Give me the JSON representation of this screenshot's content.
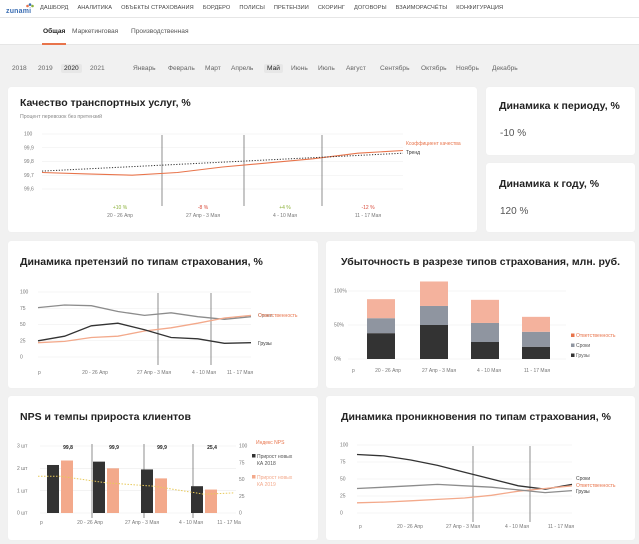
{
  "brand": {
    "logo_text": "zunami",
    "accent": "#e8744b",
    "dark": "#333333",
    "mid": "#8c8c8c"
  },
  "topnav": [
    "ДАШБОРД",
    "АНАЛИТИКА",
    "ОБЪЕКТЫ СТРАХОВАНИЯ",
    "БОРДЕРО",
    "ПОЛИСЫ",
    "ПРЕТЕНЗИИ",
    "СКОРИНГ",
    "ДОГОВОРЫ",
    "ВЗАИМОРАСЧЁТЫ",
    "КОНФИГУРАЦИЯ"
  ],
  "subtabs": [
    "Общая",
    "Маркетинговая",
    "Производственная"
  ],
  "years": [
    "2018",
    "2019",
    "2020",
    "2021"
  ],
  "selected_year": "2020",
  "months": [
    "Январь",
    "Февраль",
    "Март",
    "Апрель",
    "Май",
    "Июнь",
    "Июль",
    "Август",
    "Сентябрь",
    "Октябрь",
    "Ноябрь",
    "Декабрь"
  ],
  "selected_month": "Май",
  "cards": {
    "quality": {
      "title": "Качество транспортных услуг, %",
      "subtitle": "Процент перевозок без претензий"
    },
    "period": {
      "title": "Динамика к периоду, %",
      "value": "-10 %"
    },
    "year": {
      "title": "Динамика к году, %",
      "value": "120 %"
    },
    "claims": {
      "title": "Динамика претензий по типам страхования, %"
    },
    "loss": {
      "title": "Убыточность в разрезе типов страхования, млн. руб."
    },
    "nps": {
      "title": "NPS и темпы прироста клиентов"
    },
    "penetration": {
      "title": "Динамика проникновения по типам страхования, %"
    }
  },
  "chart_data": [
    {
      "type": "line",
      "title": "Качество транспортных услуг, %",
      "subtitle": "Процент перевозок без претензий",
      "x": [
        "20 - 26 Апр",
        "27 Апр - 3 Мая",
        "4 - 10 Мая",
        "11 - 17 Мая"
      ],
      "ylim": [
        99.6,
        100
      ],
      "yticks": [
        "100",
        "99,9",
        "99,8",
        "99,7",
        "99,6"
      ],
      "period_changes": [
        "+10 %",
        "-8 %",
        "+4 %",
        "-12 %"
      ],
      "change_colors": [
        "#8cb13a",
        "#d94a3a",
        "#8cb13a",
        "#d94a3a"
      ],
      "series": [
        {
          "name": "Коэффициент качества",
          "values": [
            99.72,
            99.71,
            99.7,
            99.72,
            99.76,
            99.79,
            99.82,
            99.86,
            99.88
          ]
        },
        {
          "name": "Тренд",
          "values": [
            99.73,
            99.86
          ]
        }
      ]
    },
    {
      "type": "line",
      "title": "Динамика претензий по типам страхования, %",
      "x": [
        "20 - 26 Апр",
        "27 Апр - 3 Мая",
        "4 - 10 Мая",
        "11 - 17 Мая"
      ],
      "first_tick": "р",
      "ylim": [
        0,
        100
      ],
      "yticks": [
        "100",
        "75",
        "50",
        "25",
        "0"
      ],
      "series": [
        {
          "name": "Сроки",
          "values": [
            76,
            80,
            79,
            70,
            64,
            68,
            62,
            58,
            62
          ]
        },
        {
          "name": "Ответственность",
          "values": [
            22,
            24,
            30,
            32,
            40,
            45,
            52,
            60,
            64
          ]
        },
        {
          "name": "Грузы",
          "values": [
            25,
            32,
            48,
            52,
            42,
            30,
            28,
            21,
            22
          ]
        }
      ]
    },
    {
      "type": "bar",
      "stacked": true,
      "title": "Убыточность в разрезе типов страхования, млн. руб.",
      "categories": [
        "20 - 26 Апр",
        "27 Апр - 3 Мая",
        "4 - 10 Мая",
        "11 - 17 Мая"
      ],
      "first_tick": "р",
      "ylim": [
        0,
        100
      ],
      "yticks": [
        "100%",
        "50%",
        "0%"
      ],
      "series": [
        {
          "name": "Ответственность",
          "values": [
            28,
            36,
            34,
            22
          ]
        },
        {
          "name": "Сроки",
          "values": [
            22,
            28,
            28,
            22
          ]
        },
        {
          "name": "Грузы",
          "values": [
            38,
            50,
            25,
            18
          ]
        }
      ]
    },
    {
      "type": "bar",
      "title": "NPS и темпы прироста клиентов",
      "categories": [
        "20 - 26 Апр",
        "27 Апр - 3 Мая",
        "4 - 10 Мая",
        "11 - 17 Ма"
      ],
      "first_tick": "р",
      "bar_labels": [
        "99,8",
        "99,9",
        "99,9",
        "25,4"
      ],
      "left_yticks": [
        "3 шт",
        "2 шт",
        "1 шт",
        "0 шт"
      ],
      "right_yticks": [
        "100",
        "75",
        "50",
        "25",
        "0"
      ],
      "series": [
        {
          "name": "Индекс NPS",
          "values": [
            55,
            45,
            40,
            28
          ]
        },
        {
          "name": "Прирост новых КА 2018",
          "values": [
            2.15,
            2.3,
            1.95,
            1.2
          ]
        },
        {
          "name": "Прирост новых КА 2019",
          "values": [
            2.35,
            2.0,
            1.55,
            1.05
          ]
        }
      ]
    },
    {
      "type": "line",
      "title": "Динамика проникновения по типам страхования, %",
      "x": [
        "20 - 26 Апр",
        "27 Апр - 3 Мая",
        "4 - 10 Мая",
        "11 - 17 Мая"
      ],
      "first_tick": "р",
      "ylim": [
        0,
        100
      ],
      "yticks": [
        "100",
        "75",
        "50",
        "25",
        "0"
      ],
      "series": [
        {
          "name": "Сроки",
          "values": [
            86,
            84,
            78,
            70,
            60,
            50,
            40,
            35,
            42
          ]
        },
        {
          "name": "Ответственность",
          "values": [
            15,
            16,
            18,
            20,
            22,
            26,
            32,
            36,
            40
          ]
        },
        {
          "name": "Грузы",
          "values": [
            36,
            38,
            40,
            42,
            40,
            38,
            34,
            30,
            33
          ]
        }
      ]
    }
  ]
}
